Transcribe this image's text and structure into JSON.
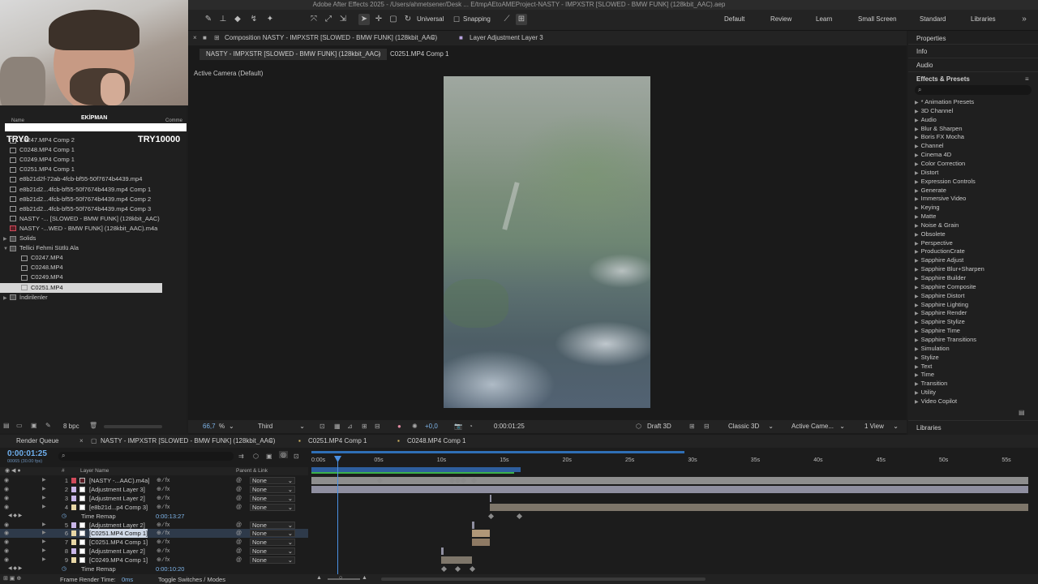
{
  "window_title": "Adobe After Effects 2025 - /Users/ahmetsener/Desk ... E/tmpAEtoAMEProject-NASTY - IMPXSTR [SLOWED - BMW FUNK] (128kbit_AAC).aep",
  "toolbar": {
    "universal": "Universal",
    "snapping": "Snapping",
    "workspaces": [
      "Default",
      "Review",
      "Learn",
      "Small Screen",
      "Standard",
      "Libraries"
    ]
  },
  "overlay": {
    "title": "EKİPMAN",
    "left": "TRY0",
    "right": "TRY10000",
    "col_name": "Name",
    "col_comment": "Comme"
  },
  "project_items": [
    {
      "name": "C0247.MP4 Comp 2",
      "icon": "comp",
      "indent": 1
    },
    {
      "name": "C0248.MP4 Comp 1",
      "icon": "comp",
      "indent": 1
    },
    {
      "name": "C0249.MP4 Comp 1",
      "icon": "comp",
      "indent": 1
    },
    {
      "name": "C0251.MP4 Comp 1",
      "icon": "comp",
      "indent": 1
    },
    {
      "name": "e8b21d2f-72ab-4fcb-bf55-50f7674b4439.mp4",
      "icon": "footage",
      "indent": 1
    },
    {
      "name": "e8b21d2...4fcb-bf55-50f7674b4439.mp4 Comp 1",
      "icon": "comp",
      "indent": 1
    },
    {
      "name": "e8b21d2...4fcb-bf55-50f7674b4439.mp4 Comp 2",
      "icon": "comp",
      "indent": 1
    },
    {
      "name": "e8b21d2...4fcb-bf55-50f7674b4439.mp4 Comp 3",
      "icon": "comp",
      "indent": 1
    },
    {
      "name": "NASTY -... [SLOWED - BMW FUNK] (128kbit_AAC)",
      "icon": "comp",
      "indent": 1
    },
    {
      "name": "NASTY -...WED - BMW FUNK] (128kbit_AAC).m4a",
      "icon": "audio",
      "indent": 1
    },
    {
      "name": "Solids",
      "icon": "folder",
      "indent": 0,
      "tri": "▶"
    },
    {
      "name": "Tellici Fehmi Sütlü Ala",
      "icon": "folder",
      "indent": 0,
      "tri": "▼"
    },
    {
      "name": "C0247.MP4",
      "icon": "footage",
      "indent": 2
    },
    {
      "name": "C0248.MP4",
      "icon": "footage",
      "indent": 2
    },
    {
      "name": "C0249.MP4",
      "icon": "footage",
      "indent": 2
    },
    {
      "name": "C0251.MP4",
      "icon": "footage",
      "indent": 2,
      "selected": true
    },
    {
      "name": "İndirilenler",
      "icon": "folder",
      "indent": 0,
      "tri": "▶"
    }
  ],
  "project_footer": {
    "bpc": "8 bpc"
  },
  "comp_panel": {
    "tab": "Composition NASTY - IMPXSTR [SLOWED - BMW FUNK] (128kbit_AAC)",
    "layer_tab": "Layer Adjustment Layer 3",
    "viewer_tabs": [
      "NASTY - IMPXSTR [SLOWED - BMW FUNK] (128kbit_AAC)",
      "C0251.MP4 Comp 1"
    ],
    "camera_label": "Active Camera (Default)"
  },
  "viewer_bar": {
    "zoom": "66,7",
    "zoom_unit": "%",
    "resolution": "Third",
    "exposure": "+0,0",
    "timecode": "0:00:01:25",
    "draft": "Draft 3D",
    "renderer": "Classic 3D",
    "camera": "Active Came...",
    "views": "1 View"
  },
  "right_panel": {
    "sections": [
      "Properties",
      "Info",
      "Audio"
    ],
    "effects_title": "Effects & Presets",
    "search_placeholder": "",
    "effects": [
      "* Animation Presets",
      "3D Channel",
      "Audio",
      "Blur & Sharpen",
      "Boris FX Mocha",
      "Channel",
      "Cinema 4D",
      "Color Correction",
      "Distort",
      "Expression Controls",
      "Generate",
      "Immersive Video",
      "Keying",
      "Matte",
      "Noise & Grain",
      "Obsolete",
      "Perspective",
      "ProductionCrate",
      "Sapphire Adjust",
      "Sapphire Blur+Sharpen",
      "Sapphire Builder",
      "Sapphire Composite",
      "Sapphire Distort",
      "Sapphire Lighting",
      "Sapphire Render",
      "Sapphire Stylize",
      "Sapphire Time",
      "Sapphire Transitions",
      "Simulation",
      "Stylize",
      "Text",
      "Time",
      "Transition",
      "Utility",
      "Video Copilot"
    ],
    "libraries": "Libraries"
  },
  "timeline": {
    "tabs": [
      "Render Queue",
      "NASTY - IMPXSTR [SLOWED - BMW FUNK] (128kbit_AAC)",
      "C0251.MP4 Comp 1",
      "C0248.MP4 Comp 1"
    ],
    "timecode": "0:00:01:25",
    "fps_note": "00065 (30.00 fps)",
    "col_hash": "#",
    "col_layer": "Layer Name",
    "col_parent": "Parent & Link",
    "ruler": [
      "0:00s",
      "05s",
      "10s",
      "15s",
      "20s",
      "25s",
      "30s",
      "35s",
      "40s",
      "45s",
      "50s",
      "55s"
    ],
    "layers": [
      {
        "num": "1",
        "name": "[NASTY -...AAC).m4a]",
        "parent": "None",
        "color": "#d04a5a"
      },
      {
        "num": "2",
        "name": "[Adjustment Layer 3]",
        "parent": "None",
        "color": "#c9b6e8"
      },
      {
        "num": "3",
        "name": "[Adjustment Layer 2]",
        "parent": "None",
        "color": "#c9b6e8"
      },
      {
        "num": "4",
        "name": "[e8b21d...p4 Comp 3]",
        "parent": "None",
        "color": "#e8d7a6"
      },
      {
        "num": "",
        "name": "Time Remap",
        "parent": "",
        "time": "0:00:13:27",
        "color": ""
      },
      {
        "num": "5",
        "name": "[Adjustment Layer 2]",
        "parent": "None",
        "color": "#c9b6e8"
      },
      {
        "num": "6",
        "name": "[C0251.MP4 Comp 1]",
        "parent": "None",
        "color": "#e8d7a6"
      },
      {
        "num": "7",
        "name": "[C0251.MP4 Comp 1]",
        "parent": "None",
        "color": "#e8d7a6"
      },
      {
        "num": "8",
        "name": "[Adjustment Layer 2]",
        "parent": "None",
        "color": "#c9b6e8"
      },
      {
        "num": "9",
        "name": "[C0249.MP4 Comp 1]",
        "parent": "None",
        "color": "#e8d7a6"
      },
      {
        "num": "",
        "name": "Time Remap",
        "parent": "",
        "time": "0:00:10:20",
        "color": ""
      }
    ],
    "frame_render_label": "Frame Render Time:",
    "frame_render_value": "0ms",
    "toggle": "Toggle Switches / Modes"
  }
}
